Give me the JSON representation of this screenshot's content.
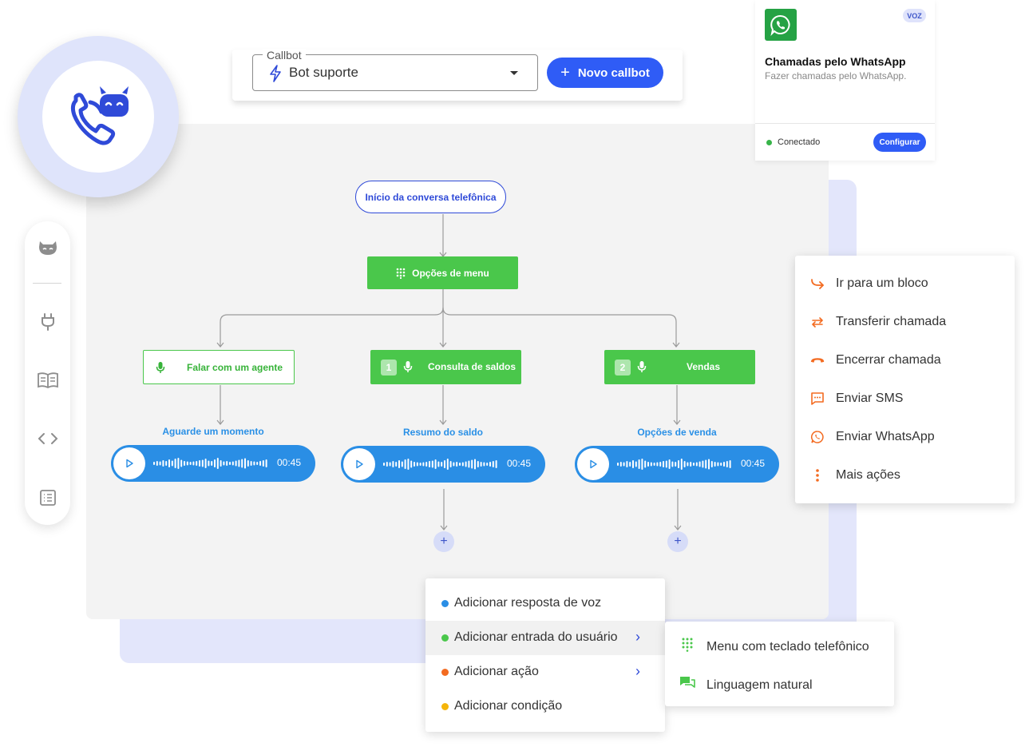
{
  "colors": {
    "brand_blue": "#2f5cf6",
    "green": "#4ac74b",
    "audio_blue": "#2a8ee5",
    "orange": "#f36b21",
    "yellow": "#f5b50a"
  },
  "header": {
    "select_legend": "Callbot",
    "select_value": "Bot suporte",
    "new_button": "Novo callbot"
  },
  "whatsapp_card": {
    "badge": "VOZ",
    "title": "Chamadas pelo WhatsApp",
    "subtitle": "Fazer chamadas pelo WhatsApp.",
    "status": "Conectado",
    "button": "Configurar"
  },
  "sidebar": {
    "items": [
      {
        "icon": "bot-icon"
      },
      {
        "icon": "plug-icon"
      },
      {
        "icon": "book-icon"
      },
      {
        "icon": "code-icon"
      },
      {
        "icon": "list-icon"
      }
    ]
  },
  "flow": {
    "start": "Início da conversa telefônica",
    "menu": "Opções de menu",
    "branches": [
      {
        "label": "Falar com um agente",
        "number": "",
        "step": "Aguarde um momento",
        "duration": "00:45"
      },
      {
        "label": "Consulta de saldos",
        "number": "1",
        "step": "Resumo do saldo",
        "duration": "00:45"
      },
      {
        "label": "Vendas",
        "number": "2",
        "step": "Opções de venda",
        "duration": "00:45"
      }
    ],
    "plus": "+"
  },
  "actions_menu": {
    "items": [
      {
        "label": "Ir para um bloco",
        "icon": "redirect-arrow-icon"
      },
      {
        "label": "Transferir chamada",
        "icon": "transfer-arrows-icon"
      },
      {
        "label": "Encerrar chamada",
        "icon": "hang-up-icon"
      },
      {
        "label": "Enviar SMS",
        "icon": "sms-icon"
      },
      {
        "label": "Enviar WhatsApp",
        "icon": "whatsapp-icon"
      },
      {
        "label": "Mais ações",
        "icon": "more-vertical-icon"
      }
    ]
  },
  "add_menu": {
    "items": [
      {
        "label": "Adicionar resposta de voz",
        "color": "#2a8ee5"
      },
      {
        "label": "Adicionar entrada do usuário",
        "color": "#4ac74b"
      },
      {
        "label": "Adicionar ação",
        "color": "#f36b21"
      },
      {
        "label": "Adicionar condição",
        "color": "#f5b50a"
      }
    ],
    "submenu": [
      {
        "label": "Menu com teclado telefônico",
        "icon": "keypad-icon"
      },
      {
        "label": "Linguagem natural",
        "icon": "chat-bubbles-icon"
      }
    ]
  }
}
